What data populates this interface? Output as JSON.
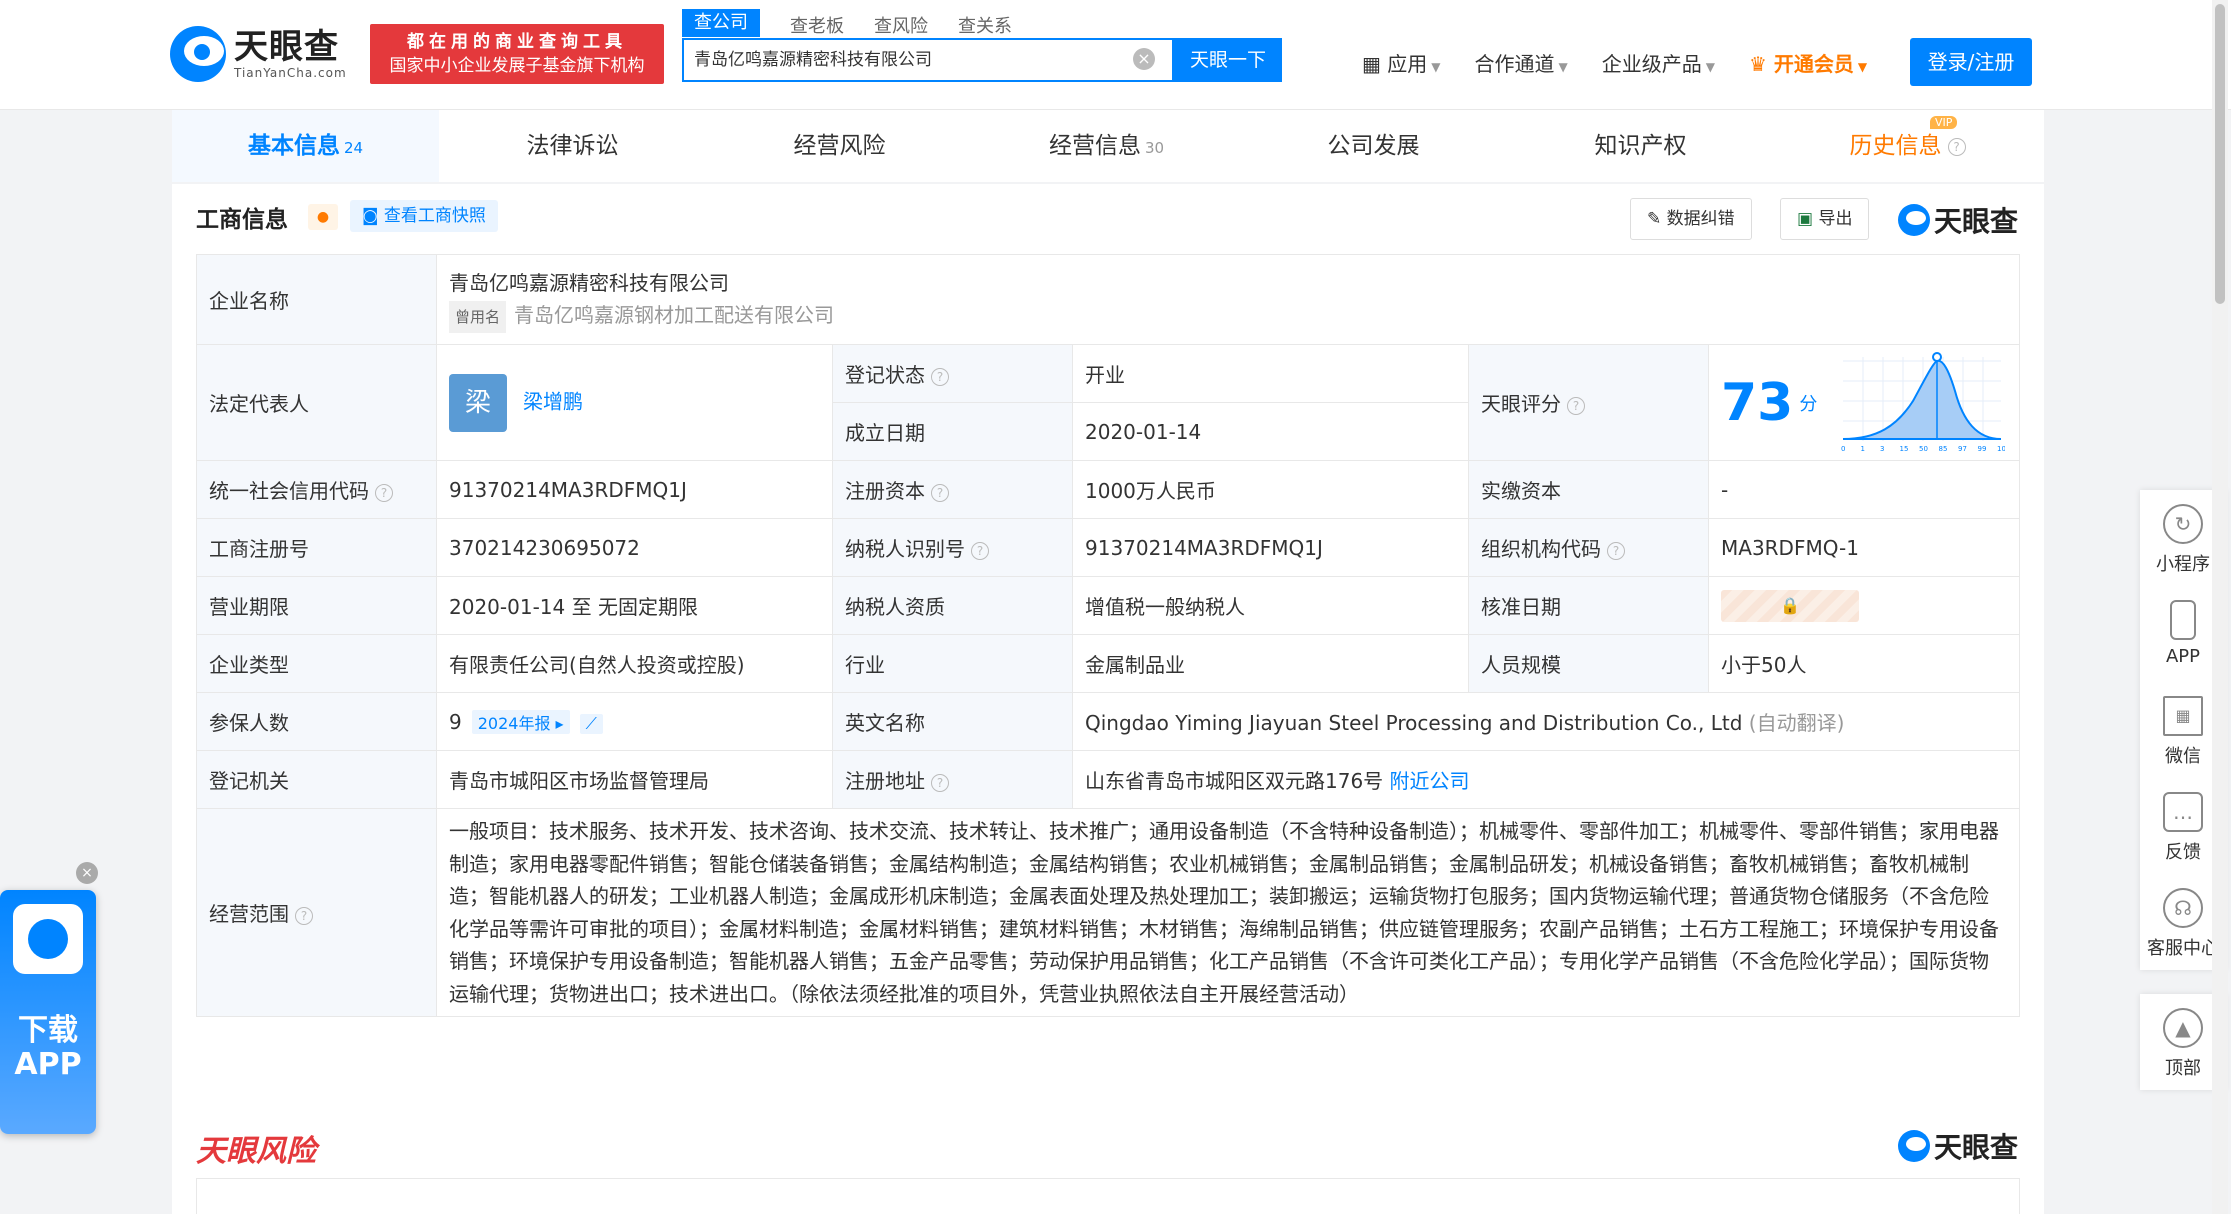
{
  "header": {
    "logo_cn": "天眼查",
    "logo_en": "TianYanCha.com",
    "slogan_line1": "都在用的商业查询工具",
    "slogan_line2": "国家中小企业发展子基金旗下机构",
    "search_tabs": [
      "查公司",
      "查老板",
      "查风险",
      "查关系"
    ],
    "search_value": "青岛亿鸣嘉源精密科技有限公司",
    "search_button": "天眼一下",
    "nav": {
      "apps": "应用",
      "channel": "合作通道",
      "enterprise": "企业级产品",
      "vip": "开通会员"
    },
    "login": "登录/注册"
  },
  "tabs": [
    {
      "label": "基本信息",
      "count": "24"
    },
    {
      "label": "法律诉讼",
      "count": ""
    },
    {
      "label": "经营风险",
      "count": ""
    },
    {
      "label": "经营信息",
      "count": "30"
    },
    {
      "label": "公司发展",
      "count": ""
    },
    {
      "label": "知识产权",
      "count": ""
    },
    {
      "label": "历史信息",
      "count": ""
    }
  ],
  "vip_badge": "VIP",
  "section": {
    "title": "工商信息",
    "snapshot": "查看工商快照",
    "correct": "数据纠错",
    "export": "导出",
    "brand": "天眼查"
  },
  "info": {
    "company_name_label": "企业名称",
    "company_name": "青岛亿鸣嘉源精密科技有限公司",
    "used_name_tag": "曾用名",
    "used_name": "青岛亿鸣嘉源钢材加工配送有限公司",
    "legal_rep_label": "法定代表人",
    "legal_rep_avatar": "梁",
    "legal_rep": "梁增鹏",
    "reg_status_label": "登记状态",
    "reg_status": "开业",
    "est_date_label": "成立日期",
    "est_date": "2020-01-14",
    "score_label": "天眼评分",
    "score": "73",
    "score_unit": "分",
    "credit_code_label": "统一社会信用代码",
    "credit_code": "91370214MA3RDFMQ1J",
    "reg_capital_label": "注册资本",
    "reg_capital": "1000万人民币",
    "paid_capital_label": "实缴资本",
    "paid_capital": "-",
    "reg_no_label": "工商注册号",
    "reg_no": "370214230695072",
    "taxpayer_id_label": "纳税人识别号",
    "taxpayer_id": "91370214MA3RDFMQ1J",
    "org_code_label": "组织机构代码",
    "org_code": "MA3RDFMQ-1",
    "term_label": "营业期限",
    "term": "2020-01-14 至 无固定期限",
    "taxpayer_qual_label": "纳税人资质",
    "taxpayer_qual": "增值税一般纳税人",
    "approval_date_label": "核准日期",
    "type_label": "企业类型",
    "type": "有限责任公司(自然人投资或控股)",
    "industry_label": "行业",
    "industry": "金属制品业",
    "staff_size_label": "人员规模",
    "staff_size": "小于50人",
    "insured_label": "参保人数",
    "insured": "9",
    "report_tag": "2024年报",
    "english_name_label": "英文名称",
    "english_name": "Qingdao Yiming Jiayuan Steel Processing and Distribution Co., Ltd",
    "auto_translate": "(自动翻译)",
    "authority_label": "登记机关",
    "authority": "青岛市城阳区市场监督管理局",
    "address_label": "注册地址",
    "address": "山东省青岛市城阳区双元路176号",
    "nearby": "附近公司",
    "scope_label": "经营范围",
    "scope": "一般项目：技术服务、技术开发、技术咨询、技术交流、技术转让、技术推广；通用设备制造（不含特种设备制造）；机械零件、零部件加工；机械零件、零部件销售；家用电器制造；家用电器零配件销售；智能仓储装备销售；金属结构制造；金属结构销售；农业机械销售；金属制品销售；金属制品研发；机械设备销售；畜牧机械销售；畜牧机械制造；智能机器人的研发；工业机器人制造；金属成形机床制造；金属表面处理及热处理加工；装卸搬运；运输货物打包服务；国内货物运输代理；普通货物仓储服务（不含危险化学品等需许可审批的项目）；金属材料制造；金属材料销售；建筑材料销售；木材销售；海绵制品销售；供应链管理服务；农副产品销售；土石方工程施工；环境保护专用设备销售；环境保护专用设备制造；智能机器人销售；五金产品零售；劳动保护用品销售；化工产品销售（不含许可类化工产品）；专用化学产品销售（不含危险化学品）；国际货物运输代理；货物进出口；技术进出口。（除依法须经批准的项目外，凭营业执照依法自主开展经营活动）"
  },
  "score_chart": {
    "ticks": [
      "0",
      "1",
      "3",
      "15",
      "50",
      "85",
      "97",
      "99",
      "100"
    ],
    "marker": 73
  },
  "risk": {
    "title": "天眼风险",
    "brand": "天眼查"
  },
  "sidebar": [
    "小程序",
    "APP",
    "微信",
    "反馈",
    "客服中心"
  ],
  "back_top": "顶部",
  "download": {
    "line1": "下载",
    "line2": "APP"
  },
  "colors": {
    "brand": "#0084ff",
    "vip": "#ff7a00",
    "slogan_bg": "#e4393c",
    "status_green": "#13a10e"
  }
}
